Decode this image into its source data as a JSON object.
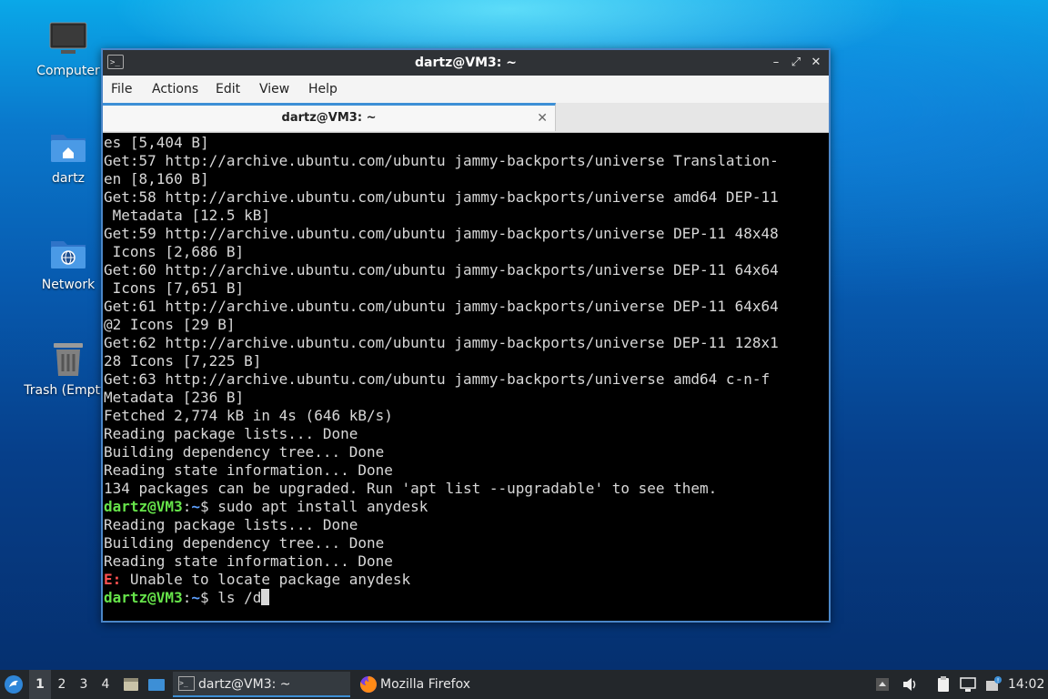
{
  "desktop": {
    "icons": [
      {
        "label": "Computer",
        "icon": "computer-icon"
      },
      {
        "label": "dartz",
        "icon": "home-folder-icon"
      },
      {
        "label": "Network",
        "icon": "network-folder-icon"
      },
      {
        "label": "Trash (Empty)",
        "icon": "trash-icon"
      }
    ]
  },
  "window": {
    "title": "dartz@VM3: ~",
    "menu": [
      "File",
      "Actions",
      "Edit",
      "View",
      "Help"
    ],
    "tab_title": "dartz@VM3: ~",
    "controls": {
      "minimize": "–",
      "maximize": "⤢",
      "close": "✕"
    }
  },
  "terminal": {
    "lines": [
      "es [5,404 B]",
      "Get:57 http://archive.ubuntu.com/ubuntu jammy-backports/universe Translation-",
      "en [8,160 B]",
      "Get:58 http://archive.ubuntu.com/ubuntu jammy-backports/universe amd64 DEP-11",
      " Metadata [12.5 kB]",
      "Get:59 http://archive.ubuntu.com/ubuntu jammy-backports/universe DEP-11 48x48",
      " Icons [2,686 B]",
      "Get:60 http://archive.ubuntu.com/ubuntu jammy-backports/universe DEP-11 64x64",
      " Icons [7,651 B]",
      "Get:61 http://archive.ubuntu.com/ubuntu jammy-backports/universe DEP-11 64x64",
      "@2 Icons [29 B]",
      "Get:62 http://archive.ubuntu.com/ubuntu jammy-backports/universe DEP-11 128x1",
      "28 Icons [7,225 B]",
      "Get:63 http://archive.ubuntu.com/ubuntu jammy-backports/universe amd64 c-n-f",
      "Metadata [236 B]",
      "Fetched 2,774 kB in 4s (646 kB/s)",
      "Reading package lists... Done",
      "Building dependency tree... Done",
      "Reading state information... Done",
      "134 packages can be upgraded. Run 'apt list --upgradable' to see them."
    ],
    "prompt_user": "dartz@VM3",
    "prompt_sep": ":",
    "prompt_path": "~",
    "prompt_sym": "$ ",
    "command1": "sudo apt install anydesk",
    "lines2": [
      "Reading package lists... Done",
      "Building dependency tree... Done",
      "Reading state information... Done"
    ],
    "error_prefix": "E:",
    "error_message": " Unable to locate package anydesk",
    "current_input": "ls /d"
  },
  "taskbar": {
    "workspaces": [
      "1",
      "2",
      "3",
      "4"
    ],
    "active_workspace": "1",
    "tasks": [
      {
        "label": "dartz@VM3: ~",
        "icon": "terminal-icon",
        "active": true
      },
      {
        "label": "Mozilla Firefox",
        "icon": "firefox-icon",
        "active": false
      }
    ],
    "clock": "14:02"
  },
  "colors": {
    "prompt_user": "#66e34a",
    "prompt_path": "#5da0ff",
    "error": "#ff5050",
    "accent": "#3d8fd6"
  }
}
